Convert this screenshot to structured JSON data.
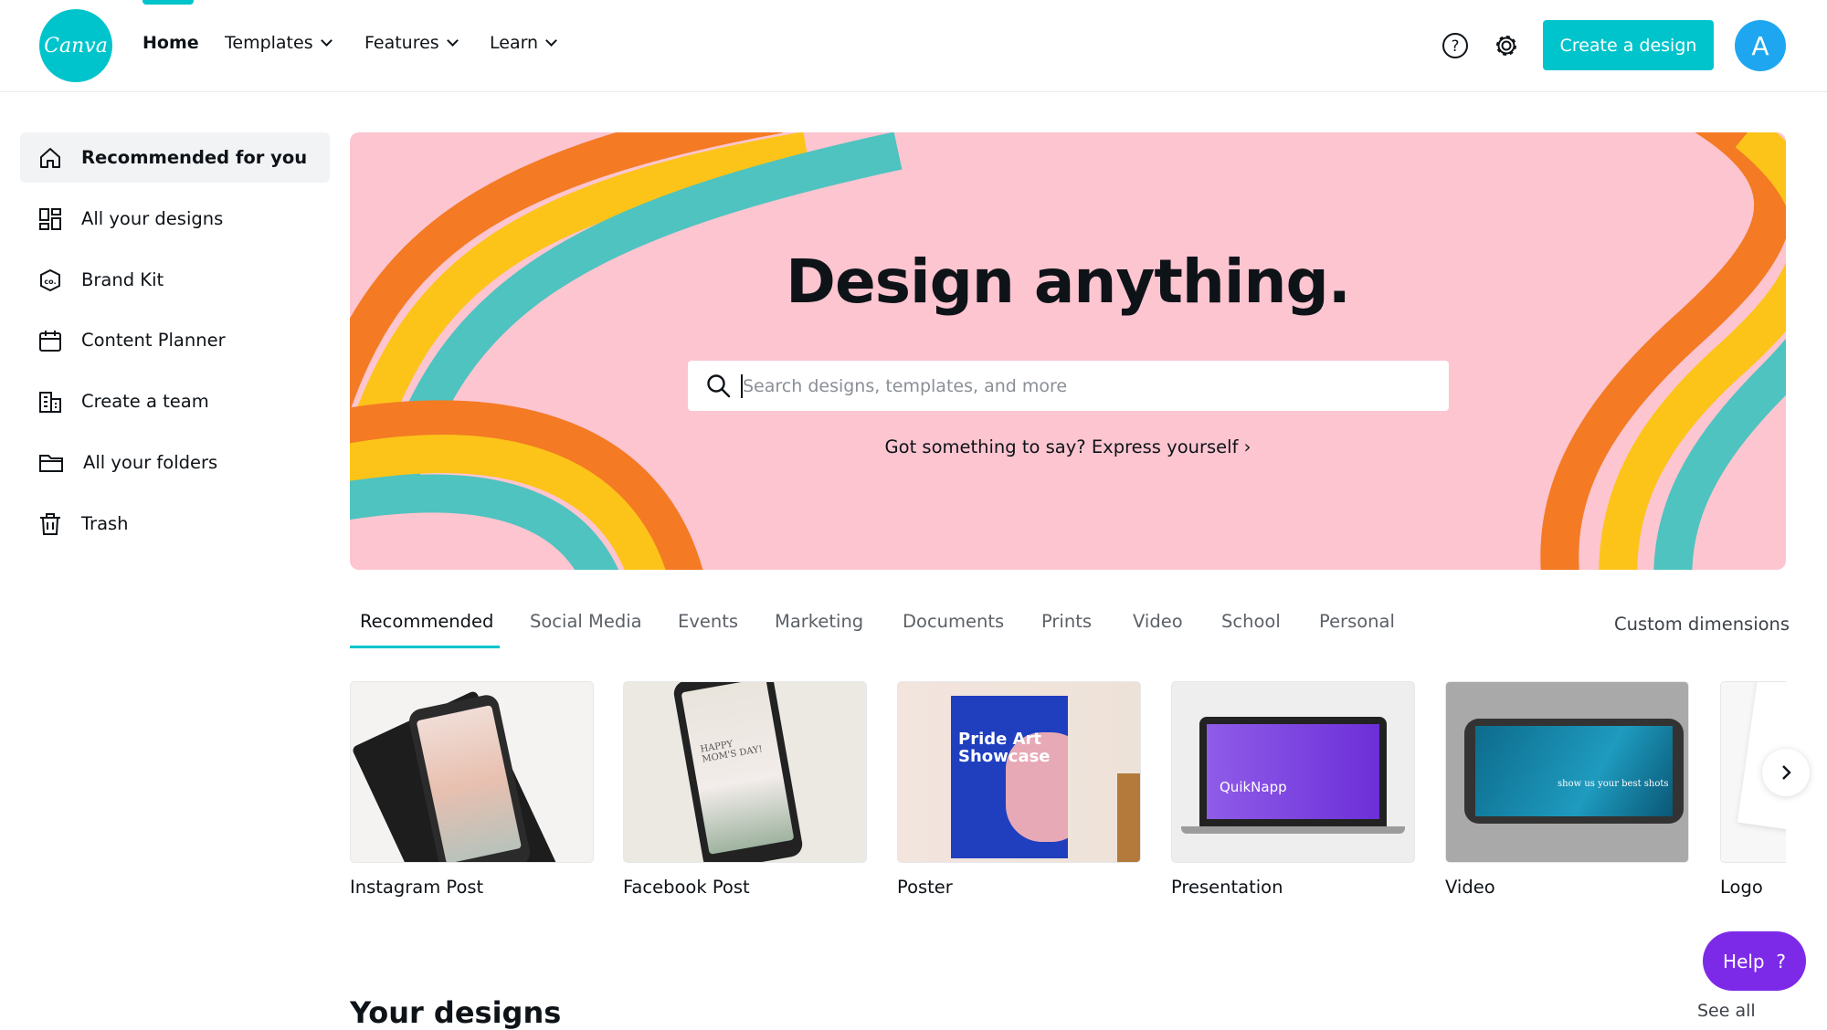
{
  "header": {
    "logo_text": "Canva",
    "nav": [
      {
        "label": "Home",
        "active": true
      },
      {
        "label": "Templates",
        "dropdown": true
      },
      {
        "label": "Features",
        "dropdown": true
      },
      {
        "label": "Learn",
        "dropdown": true
      }
    ],
    "help_icon": "question-circle-icon",
    "settings_icon": "gear-icon",
    "create_label": "Create a design",
    "avatar_initial": "A"
  },
  "sidebar": {
    "items": [
      {
        "label": "Recommended for you",
        "icon": "home-icon",
        "active": true
      },
      {
        "label": "All your designs",
        "icon": "grid-icon"
      },
      {
        "label": "Brand Kit",
        "icon": "brand-kit-icon"
      },
      {
        "label": "Content Planner",
        "icon": "calendar-icon"
      },
      {
        "label": "Create a team",
        "icon": "building-icon"
      },
      {
        "label": "All your folders",
        "icon": "folder-icon"
      },
      {
        "label": "Trash",
        "icon": "trash-icon"
      }
    ]
  },
  "hero": {
    "title": "Design anything.",
    "search_placeholder": "Search designs, templates, and more",
    "link": "Got something to say? Express yourself ›"
  },
  "tabs": {
    "items": [
      "Recommended",
      "Social Media",
      "Events",
      "Marketing",
      "Documents",
      "Prints",
      "Video",
      "School",
      "Personal"
    ],
    "active": "Recommended",
    "custom": "Custom dimensions"
  },
  "cards": [
    {
      "label": "Instagram Post"
    },
    {
      "label": "Facebook Post",
      "thumb_text": "HAPPY MOM'S DAY!"
    },
    {
      "label": "Poster",
      "thumb_text": "Pride Art Showcase"
    },
    {
      "label": "Presentation",
      "thumb_text": "QuikNapp"
    },
    {
      "label": "Video",
      "thumb_text": "show us your best shots"
    },
    {
      "label": "Logo"
    }
  ],
  "help_button": "Help  ?",
  "section": {
    "title": "Your designs",
    "see_all": "See all"
  },
  "colors": {
    "brand": "#00c4cc",
    "help": "#7d2ae8",
    "hero_bg": "#fcc5d0"
  }
}
